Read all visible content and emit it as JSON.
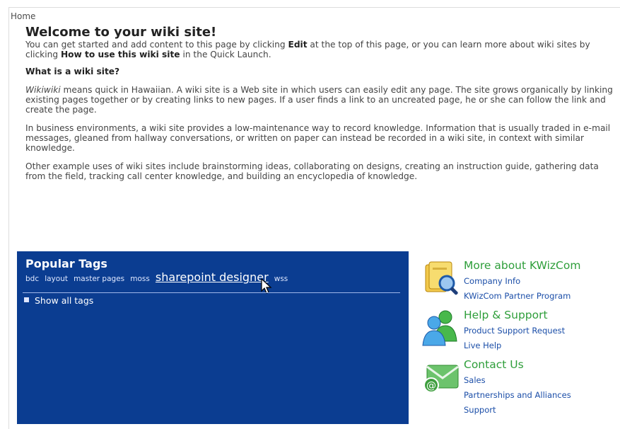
{
  "breadcrumb": "Home",
  "page": {
    "title": "Welcome to your wiki site!",
    "intro_a": "You can get started and add content to this page by clicking ",
    "intro_edit": "Edit",
    "intro_b": " at the top of this page, or you can learn more about wiki sites by clicking ",
    "intro_howto": "How to use this wiki site",
    "intro_c": " in the Quick Launch.",
    "section_heading": "What is a wiki site?",
    "p1_term": "Wikiwiki",
    "p1": " means quick in Hawaiian. A wiki site is a Web site in which users can easily edit any page. The site grows organically by linking existing pages together or by creating links to new pages. If a user finds a link to an uncreated page, he or she can follow the link and create the page.",
    "p2": "In business environments, a wiki site provides a low-maintenance way to record knowledge. Information that is usually traded in e-mail messages, gleaned from hallway conversations, or written on paper can instead be recorded in a wiki site, in context with similar knowledge.",
    "p3": "Other example uses of wiki sites include brainstorming ideas, collaborating on designs, creating an instruction guide, gathering data from the field, tracking call center knowledge, and building an encyclopedia of knowledge."
  },
  "tags": {
    "title": "Popular Tags",
    "items": [
      "bdc",
      "layout",
      "master pages",
      "moss",
      "sharepoint designer",
      "wss"
    ],
    "show_all": "Show all tags"
  },
  "sidebar": {
    "kwizcom": {
      "title": "More about KWizCom",
      "links": [
        "Company Info",
        "KWizCom Partner Program"
      ]
    },
    "help": {
      "title": "Help & Support",
      "links": [
        "Product Support Request",
        "Live Help"
      ]
    },
    "contact": {
      "title": "Contact Us",
      "links": [
        "Sales",
        "Partnerships and Alliances",
        "Support"
      ]
    }
  },
  "colors": {
    "panel": "#0b3d91",
    "accent_green": "#2e9e3a",
    "link_blue": "#1b4ea8"
  }
}
